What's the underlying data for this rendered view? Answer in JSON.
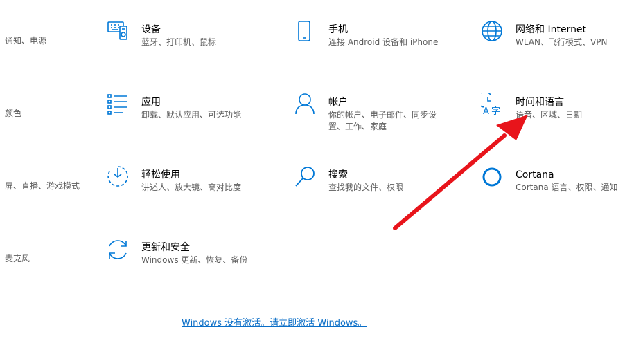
{
  "left_cut": [
    {
      "desc": "通知、电源"
    },
    {
      "desc": "颜色"
    },
    {
      "desc": "屏、直播、游戏模式"
    },
    {
      "desc": "麦克风"
    }
  ],
  "tiles": [
    {
      "title": "设备",
      "desc": "蓝牙、打印机、鼠标",
      "icon": "keyboard-device-icon"
    },
    {
      "title": "手机",
      "desc": "连接 Android 设备和 iPhone",
      "icon": "phone-icon"
    },
    {
      "title": "网络和 Internet",
      "desc": "WLAN、飞行模式、VPN",
      "icon": "globe-icon"
    },
    {
      "title": "应用",
      "desc": "卸载、默认应用、可选功能",
      "icon": "apps-list-icon"
    },
    {
      "title": "帐户",
      "desc": "你的帐户、电子邮件、同步设置、工作、家庭",
      "icon": "person-icon"
    },
    {
      "title": "时间和语言",
      "desc": "语音、区域、日期",
      "icon": "time-language-icon"
    },
    {
      "title": "轻松使用",
      "desc": "讲述人、放大镜、高对比度",
      "icon": "ease-of-access-icon"
    },
    {
      "title": "搜索",
      "desc": "查找我的文件、权限",
      "icon": "search-icon"
    },
    {
      "title": "Cortana",
      "desc": "Cortana 语言、权限、通知",
      "icon": "cortana-icon"
    },
    {
      "title": "更新和安全",
      "desc": "Windows 更新、恢复、备份",
      "icon": "update-sync-icon"
    }
  ],
  "activation_link": "Windows 没有激活。请立即激活 Windows。",
  "colors": {
    "accent": "#0078d7",
    "annotation_arrow": "#e8141b",
    "link": "#0a6ec7"
  }
}
